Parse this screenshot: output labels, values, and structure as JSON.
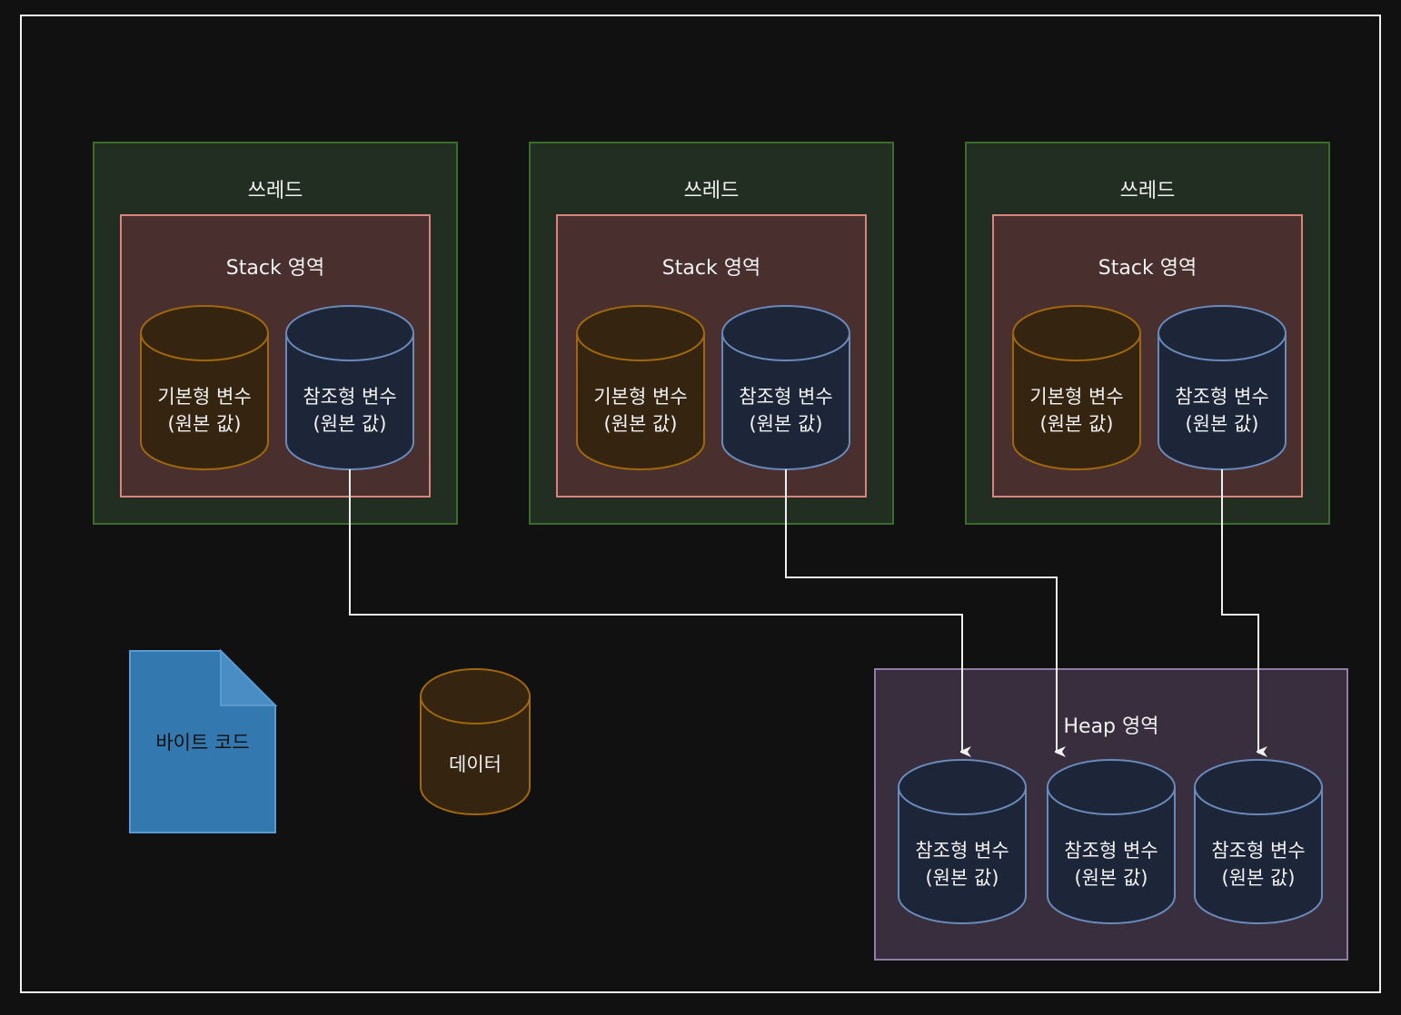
{
  "colors": {
    "background": "#111111",
    "frame": "#f0f0f0",
    "thread_fill": "#232e22",
    "thread_stroke": "#3c6b2e",
    "stack_fill": "#492f2e",
    "stack_stroke": "#d8847c",
    "heap_fill": "#382e3e",
    "heap_stroke": "#8d7ea3",
    "primitive_fill": "#35240f",
    "primitive_stroke": "#a0680a",
    "reference_fill": "#1c2638",
    "reference_stroke": "#6a89b9",
    "doc_fill": "#3379b0",
    "doc_stroke": "#5b9bd0",
    "arrow": "#f0f0f0"
  },
  "threads": [
    {
      "title": "쓰레드",
      "stack_title": "Stack 영역",
      "primitive": {
        "line1": "기본형 변수",
        "line2": "(원본 값)"
      },
      "reference": {
        "line1": "참조형 변수",
        "line2": "(원본 값)"
      }
    },
    {
      "title": "쓰레드",
      "stack_title": "Stack 영역",
      "primitive": {
        "line1": "기본형 변수",
        "line2": "(원본 값)"
      },
      "reference": {
        "line1": "참조형 변수",
        "line2": "(원본 값)"
      }
    },
    {
      "title": "쓰레드",
      "stack_title": "Stack 영역",
      "primitive": {
        "line1": "기본형 변수",
        "line2": "(원본 값)"
      },
      "reference": {
        "line1": "참조형 변수",
        "line2": "(원본 값)"
      }
    }
  ],
  "heap": {
    "title": "Heap 영역",
    "items": [
      {
        "line1": "참조형 변수",
        "line2": "(원본 값)"
      },
      {
        "line1": "참조형 변수",
        "line2": "(원본 값)"
      },
      {
        "line1": "참조형 변수",
        "line2": "(원본 값)"
      }
    ]
  },
  "bytecode": {
    "label": "바이트 코드"
  },
  "data_store": {
    "label": "데이터"
  }
}
